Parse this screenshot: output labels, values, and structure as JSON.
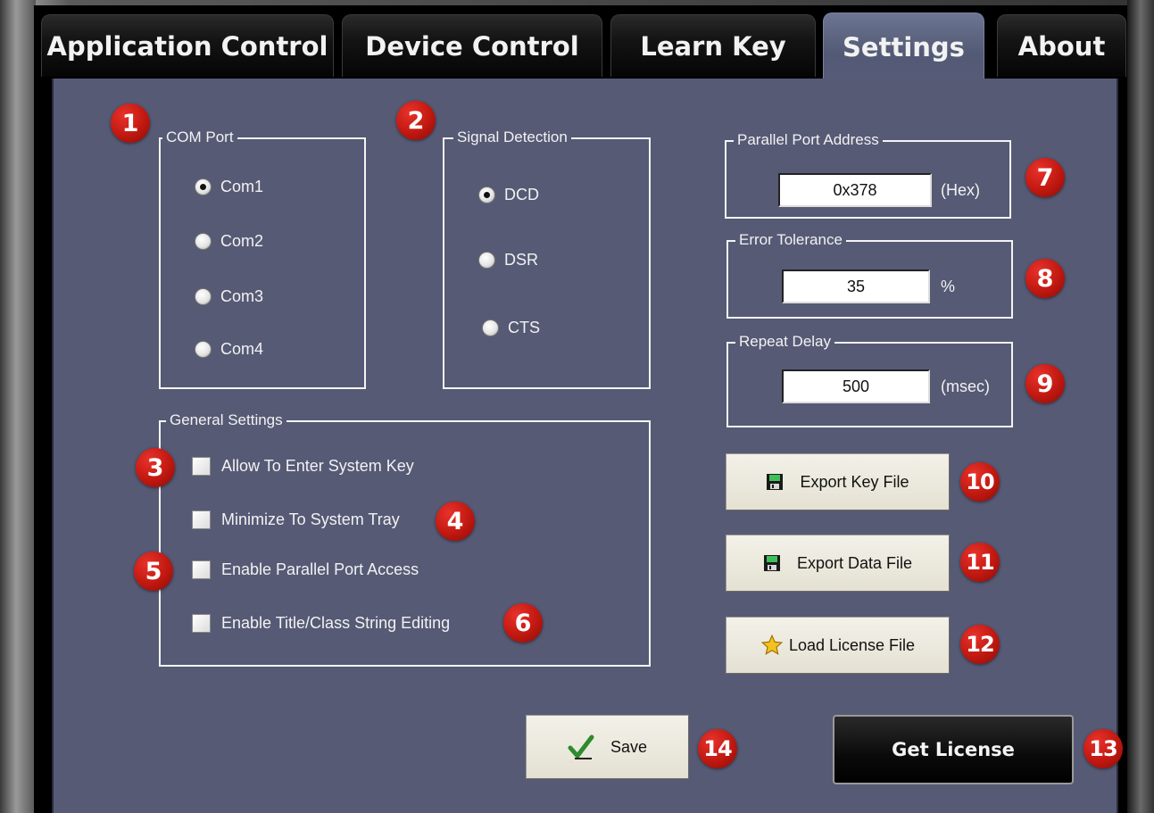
{
  "tabs": [
    {
      "label": "Application Control",
      "active": false
    },
    {
      "label": "Device Control",
      "active": false
    },
    {
      "label": "Learn Key",
      "active": false
    },
    {
      "label": "Settings",
      "active": true
    },
    {
      "label": "About",
      "active": false
    }
  ],
  "com_port": {
    "title": "COM Port",
    "options": [
      "Com1",
      "Com2",
      "Com3",
      "Com4"
    ],
    "selected": "Com1"
  },
  "signal_detection": {
    "title": "Signal Detection",
    "options": [
      "DCD",
      "DSR",
      "CTS"
    ],
    "selected": "DCD"
  },
  "general_settings": {
    "title": "General Settings",
    "items": [
      {
        "label": "Allow To Enter System Key",
        "checked": false
      },
      {
        "label": "Minimize To System Tray",
        "checked": false
      },
      {
        "label": "Enable Parallel Port Access",
        "checked": false
      },
      {
        "label": "Enable Title/Class String Editing",
        "checked": false
      }
    ]
  },
  "parallel_port": {
    "title": "Parallel Port Address",
    "value": "0x378",
    "unit": "(Hex)"
  },
  "error_tolerance": {
    "title": "Error Tolerance",
    "value": "35",
    "unit": "%"
  },
  "repeat_delay": {
    "title": "Repeat Delay",
    "value": "500",
    "unit": "(msec)"
  },
  "buttons": {
    "export_key": "Export Key File",
    "export_data": "Export Data File",
    "load_license": "Load License File",
    "save": "Save",
    "get_license": "Get License"
  },
  "badges": [
    "1",
    "2",
    "3",
    "4",
    "5",
    "6",
    "7",
    "8",
    "9",
    "10",
    "11",
    "12",
    "13",
    "14"
  ],
  "colors": {
    "panel": "#565a75",
    "badge": "#c01810",
    "tab_dark": "#0a0a0a"
  }
}
